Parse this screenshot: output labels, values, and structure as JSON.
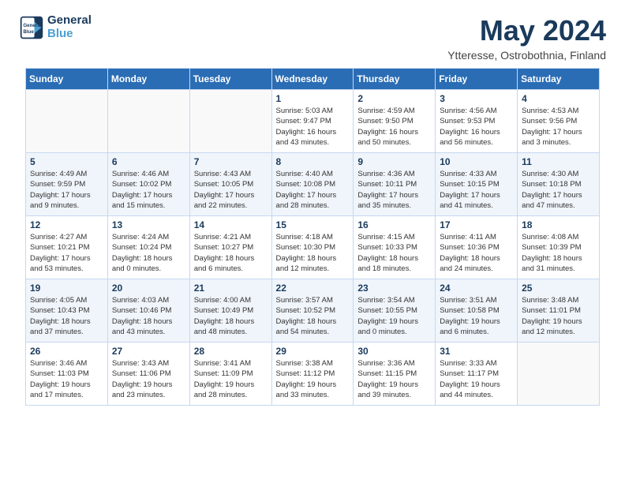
{
  "header": {
    "logo_line1": "General",
    "logo_line2": "Blue",
    "month": "May 2024",
    "location": "Ytteresse, Ostrobothnia, Finland"
  },
  "weekdays": [
    "Sunday",
    "Monday",
    "Tuesday",
    "Wednesday",
    "Thursday",
    "Friday",
    "Saturday"
  ],
  "weeks": [
    [
      {
        "day": "",
        "info": ""
      },
      {
        "day": "",
        "info": ""
      },
      {
        "day": "",
        "info": ""
      },
      {
        "day": "1",
        "info": "Sunrise: 5:03 AM\nSunset: 9:47 PM\nDaylight: 16 hours\nand 43 minutes."
      },
      {
        "day": "2",
        "info": "Sunrise: 4:59 AM\nSunset: 9:50 PM\nDaylight: 16 hours\nand 50 minutes."
      },
      {
        "day": "3",
        "info": "Sunrise: 4:56 AM\nSunset: 9:53 PM\nDaylight: 16 hours\nand 56 minutes."
      },
      {
        "day": "4",
        "info": "Sunrise: 4:53 AM\nSunset: 9:56 PM\nDaylight: 17 hours\nand 3 minutes."
      }
    ],
    [
      {
        "day": "5",
        "info": "Sunrise: 4:49 AM\nSunset: 9:59 PM\nDaylight: 17 hours\nand 9 minutes."
      },
      {
        "day": "6",
        "info": "Sunrise: 4:46 AM\nSunset: 10:02 PM\nDaylight: 17 hours\nand 15 minutes."
      },
      {
        "day": "7",
        "info": "Sunrise: 4:43 AM\nSunset: 10:05 PM\nDaylight: 17 hours\nand 22 minutes."
      },
      {
        "day": "8",
        "info": "Sunrise: 4:40 AM\nSunset: 10:08 PM\nDaylight: 17 hours\nand 28 minutes."
      },
      {
        "day": "9",
        "info": "Sunrise: 4:36 AM\nSunset: 10:11 PM\nDaylight: 17 hours\nand 35 minutes."
      },
      {
        "day": "10",
        "info": "Sunrise: 4:33 AM\nSunset: 10:15 PM\nDaylight: 17 hours\nand 41 minutes."
      },
      {
        "day": "11",
        "info": "Sunrise: 4:30 AM\nSunset: 10:18 PM\nDaylight: 17 hours\nand 47 minutes."
      }
    ],
    [
      {
        "day": "12",
        "info": "Sunrise: 4:27 AM\nSunset: 10:21 PM\nDaylight: 17 hours\nand 53 minutes."
      },
      {
        "day": "13",
        "info": "Sunrise: 4:24 AM\nSunset: 10:24 PM\nDaylight: 18 hours\nand 0 minutes."
      },
      {
        "day": "14",
        "info": "Sunrise: 4:21 AM\nSunset: 10:27 PM\nDaylight: 18 hours\nand 6 minutes."
      },
      {
        "day": "15",
        "info": "Sunrise: 4:18 AM\nSunset: 10:30 PM\nDaylight: 18 hours\nand 12 minutes."
      },
      {
        "day": "16",
        "info": "Sunrise: 4:15 AM\nSunset: 10:33 PM\nDaylight: 18 hours\nand 18 minutes."
      },
      {
        "day": "17",
        "info": "Sunrise: 4:11 AM\nSunset: 10:36 PM\nDaylight: 18 hours\nand 24 minutes."
      },
      {
        "day": "18",
        "info": "Sunrise: 4:08 AM\nSunset: 10:39 PM\nDaylight: 18 hours\nand 31 minutes."
      }
    ],
    [
      {
        "day": "19",
        "info": "Sunrise: 4:05 AM\nSunset: 10:43 PM\nDaylight: 18 hours\nand 37 minutes."
      },
      {
        "day": "20",
        "info": "Sunrise: 4:03 AM\nSunset: 10:46 PM\nDaylight: 18 hours\nand 43 minutes."
      },
      {
        "day": "21",
        "info": "Sunrise: 4:00 AM\nSunset: 10:49 PM\nDaylight: 18 hours\nand 48 minutes."
      },
      {
        "day": "22",
        "info": "Sunrise: 3:57 AM\nSunset: 10:52 PM\nDaylight: 18 hours\nand 54 minutes."
      },
      {
        "day": "23",
        "info": "Sunrise: 3:54 AM\nSunset: 10:55 PM\nDaylight: 19 hours\nand 0 minutes."
      },
      {
        "day": "24",
        "info": "Sunrise: 3:51 AM\nSunset: 10:58 PM\nDaylight: 19 hours\nand 6 minutes."
      },
      {
        "day": "25",
        "info": "Sunrise: 3:48 AM\nSunset: 11:01 PM\nDaylight: 19 hours\nand 12 minutes."
      }
    ],
    [
      {
        "day": "26",
        "info": "Sunrise: 3:46 AM\nSunset: 11:03 PM\nDaylight: 19 hours\nand 17 minutes."
      },
      {
        "day": "27",
        "info": "Sunrise: 3:43 AM\nSunset: 11:06 PM\nDaylight: 19 hours\nand 23 minutes."
      },
      {
        "day": "28",
        "info": "Sunrise: 3:41 AM\nSunset: 11:09 PM\nDaylight: 19 hours\nand 28 minutes."
      },
      {
        "day": "29",
        "info": "Sunrise: 3:38 AM\nSunset: 11:12 PM\nDaylight: 19 hours\nand 33 minutes."
      },
      {
        "day": "30",
        "info": "Sunrise: 3:36 AM\nSunset: 11:15 PM\nDaylight: 19 hours\nand 39 minutes."
      },
      {
        "day": "31",
        "info": "Sunrise: 3:33 AM\nSunset: 11:17 PM\nDaylight: 19 hours\nand 44 minutes."
      },
      {
        "day": "",
        "info": ""
      }
    ]
  ]
}
